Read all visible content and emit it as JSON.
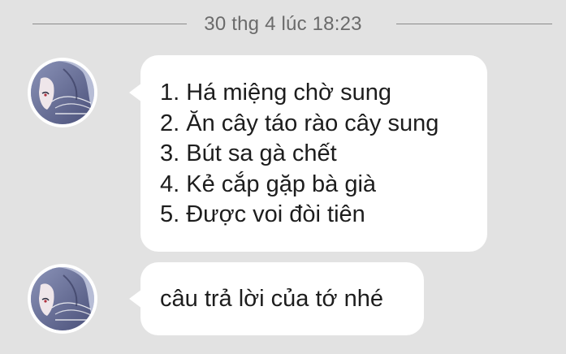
{
  "conversation": {
    "date_separator": "30 thg 4 lúc 18:23",
    "messages": [
      {
        "avatar_icon": "anime-character-avatar-icon",
        "lines": [
          "1. Há miệng chờ sung",
          "2. Ăn cây táo rào cây sung",
          "3. Bút sa gà chết",
          "4. Kẻ cắp gặp bà già",
          "5. Được voi đòi tiên"
        ]
      },
      {
        "avatar_icon": "anime-character-avatar-icon",
        "text": "câu trả lời của tớ nhé"
      }
    ]
  },
  "colors": {
    "background": "#e2e2e2",
    "bubble": "#ffffff",
    "text": "#1d1d1d",
    "date_text": "#6b6b6b"
  }
}
